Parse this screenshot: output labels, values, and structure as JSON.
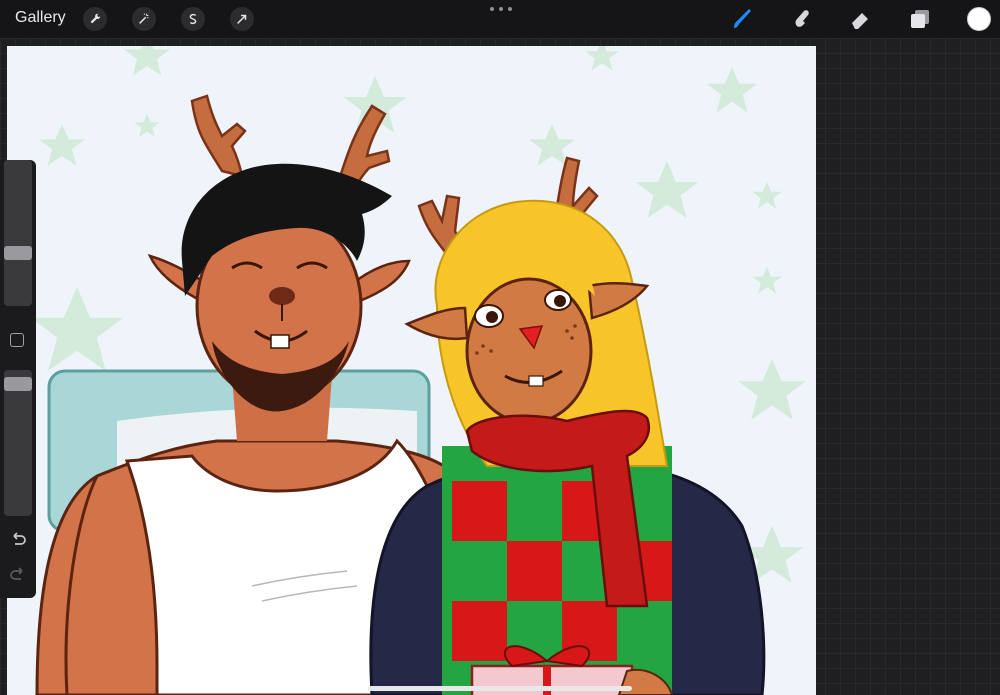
{
  "app": {
    "gallery_label": "Gallery"
  },
  "toolbar": {
    "left_tools": [
      "wrench-icon",
      "magic-wand-icon",
      "selection-s-icon",
      "transform-arrow-icon"
    ],
    "right_tools": [
      "brush-icon",
      "smudge-icon",
      "eraser-icon",
      "layers-icon"
    ],
    "active_tool": "brush-icon",
    "active_tool_color": "#1e8bff",
    "current_color": "#ffffff"
  },
  "sidebar": {
    "brush_size_level": 0.3,
    "brush_opacity_level": 0.05
  },
  "colors": {
    "background": "#eef4f9",
    "stars": "#d6ebdc",
    "sweater_navy": "#262848",
    "scarf_red": "#c41a1a",
    "checker_green": "#23a642",
    "checker_red": "#d81818",
    "hair_blonde": "#f7c52a",
    "fur": "#d27a44",
    "antler": "#c56d3e"
  }
}
